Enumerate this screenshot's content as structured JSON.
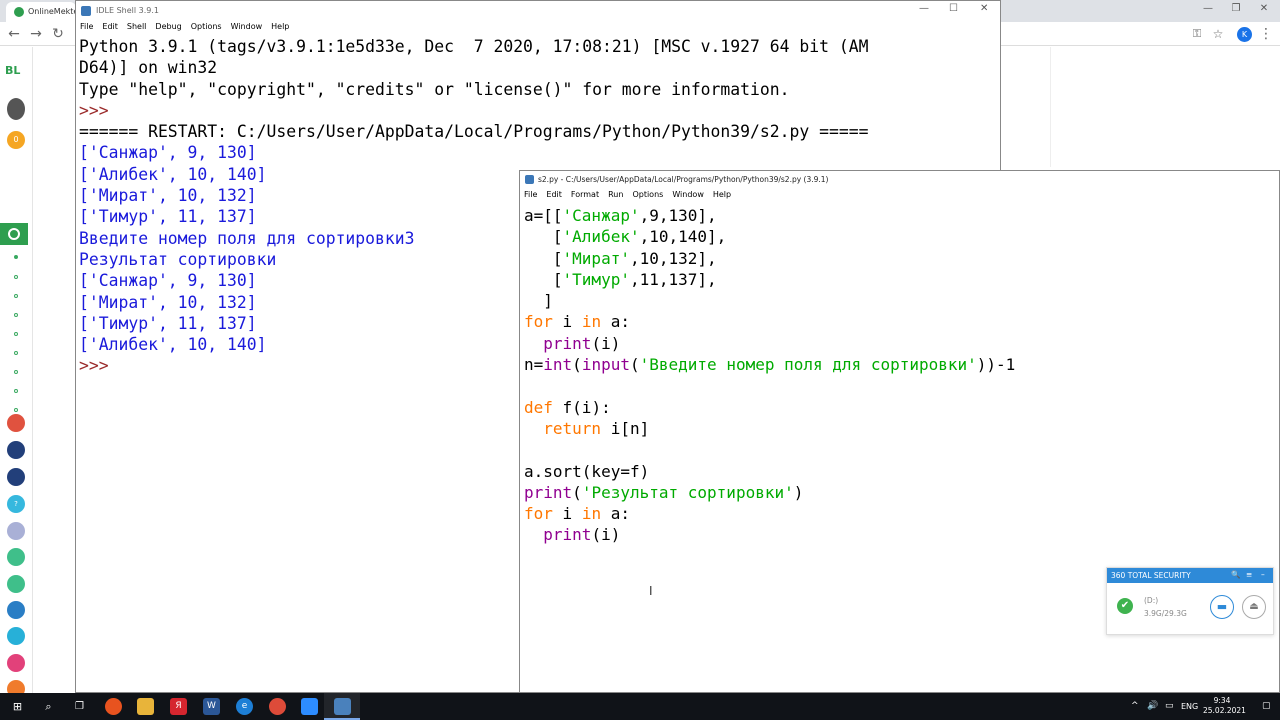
{
  "browser": {
    "tab_title": "OnlineMekte",
    "avatar_letter": "K",
    "colors": {
      "tab_icon": "#2e9e4f",
      "avatar": "#1a73e8"
    }
  },
  "sidebar": {
    "logo": "BL",
    "badge": "0",
    "items": [
      "home-icon",
      "dot",
      "dot",
      "dot",
      "dot",
      "dot",
      "dot",
      "dot",
      "dot",
      "dot"
    ],
    "apps": [
      "Smart",
      "Smart",
      "Smart",
      "?",
      "",
      "",
      "",
      "",
      "",
      "Tu4y",
      ""
    ]
  },
  "shell": {
    "title": "IDLE Shell 3.9.1",
    "menu": [
      "File",
      "Edit",
      "Shell",
      "Debug",
      "Options",
      "Window",
      "Help"
    ],
    "lines": [
      {
        "cls": "blk",
        "text": "Python 3.9.1 (tags/v3.9.1:1e5d33e, Dec  7 2020, 17:08:21) [MSC v.1927 64 bit (AM"
      },
      {
        "cls": "blk",
        "text": "D64)] on win32"
      },
      {
        "cls": "blk",
        "text": "Type \"help\", \"copyright\", \"credits\" or \"license()\" for more information."
      },
      {
        "cls": "prompt",
        "text": ">>> "
      },
      {
        "cls": "blk",
        "text": "====== RESTART: C:/Users/User/AppData/Local/Programs/Python/Python39/s2.py ====="
      },
      {
        "cls": "out",
        "text": "['Санжар', 9, 130]"
      },
      {
        "cls": "out",
        "text": "['Алибек', 10, 140]"
      },
      {
        "cls": "out",
        "text": "['Мират', 10, 132]"
      },
      {
        "cls": "out",
        "text": "['Тимур', 11, 137]"
      },
      {
        "cls": "out",
        "text": "Введите номер поля для сортировки3"
      },
      {
        "cls": "out",
        "text": "Результат сортировки"
      },
      {
        "cls": "out",
        "text": "['Санжар', 9, 130]"
      },
      {
        "cls": "out",
        "text": "['Мират', 10, 132]"
      },
      {
        "cls": "out",
        "text": "['Тимур', 11, 137]"
      },
      {
        "cls": "out",
        "text": "['Алибек', 10, 140]"
      },
      {
        "cls": "prompt",
        "text": ">>> "
      }
    ]
  },
  "editor": {
    "title": "s2.py - C:/Users/User/AppData/Local/Programs/Python/Python39/s2.py (3.9.1)",
    "menu": [
      "File",
      "Edit",
      "Format",
      "Run",
      "Options",
      "Window",
      "Help"
    ],
    "code": [
      [
        [
          "",
          "a=[["
        ],
        [
          "st",
          "'Санжар'"
        ],
        [
          "",
          ",9,130],"
        ]
      ],
      [
        [
          "",
          "   ["
        ],
        [
          "st",
          "'Алибек'"
        ],
        [
          "",
          ",10,140],"
        ]
      ],
      [
        [
          "",
          "   ["
        ],
        [
          "st",
          "'Мират'"
        ],
        [
          "",
          ",10,132],"
        ]
      ],
      [
        [
          "",
          "   ["
        ],
        [
          "st",
          "'Тимур'"
        ],
        [
          "",
          ",11,137],"
        ]
      ],
      [
        [
          "",
          "  ]"
        ]
      ],
      [
        [
          "kw",
          "for"
        ],
        [
          "",
          " i "
        ],
        [
          "kw",
          "in"
        ],
        [
          "",
          " a:"
        ]
      ],
      [
        [
          "",
          "  "
        ],
        [
          "bi",
          "print"
        ],
        [
          "",
          "(i)"
        ]
      ],
      [
        [
          "",
          "n="
        ],
        [
          "bi",
          "int"
        ],
        [
          "",
          "("
        ],
        [
          "bi",
          "input"
        ],
        [
          "",
          "("
        ],
        [
          "st",
          "'Введите номер поля для сортировки'"
        ],
        [
          "",
          "))-1"
        ]
      ],
      [
        [
          "",
          ""
        ]
      ],
      [
        [
          "kw",
          "def"
        ],
        [
          "",
          " f(i):"
        ]
      ],
      [
        [
          "",
          "  "
        ],
        [
          "kw",
          "return"
        ],
        [
          "",
          " i[n]"
        ]
      ],
      [
        [
          "",
          ""
        ]
      ],
      [
        [
          "",
          "a.sort(key=f)"
        ]
      ],
      [
        [
          "bi",
          "print"
        ],
        [
          "",
          "("
        ],
        [
          "st",
          "'Результат сортировки'"
        ],
        [
          "",
          ")"
        ]
      ],
      [
        [
          "kw",
          "for"
        ],
        [
          "",
          " i "
        ],
        [
          "kw",
          "in"
        ],
        [
          "",
          " a:"
        ]
      ],
      [
        [
          "",
          "  "
        ],
        [
          "bi",
          "print"
        ],
        [
          "",
          "(i)"
        ]
      ]
    ]
  },
  "security": {
    "title": "360 TOTAL SECURITY",
    "drive": "(D:)",
    "size": "3.9G/29.3G"
  },
  "taskbar": {
    "lang": "ENG",
    "time": "9:34",
    "date": "25.02.2021"
  }
}
